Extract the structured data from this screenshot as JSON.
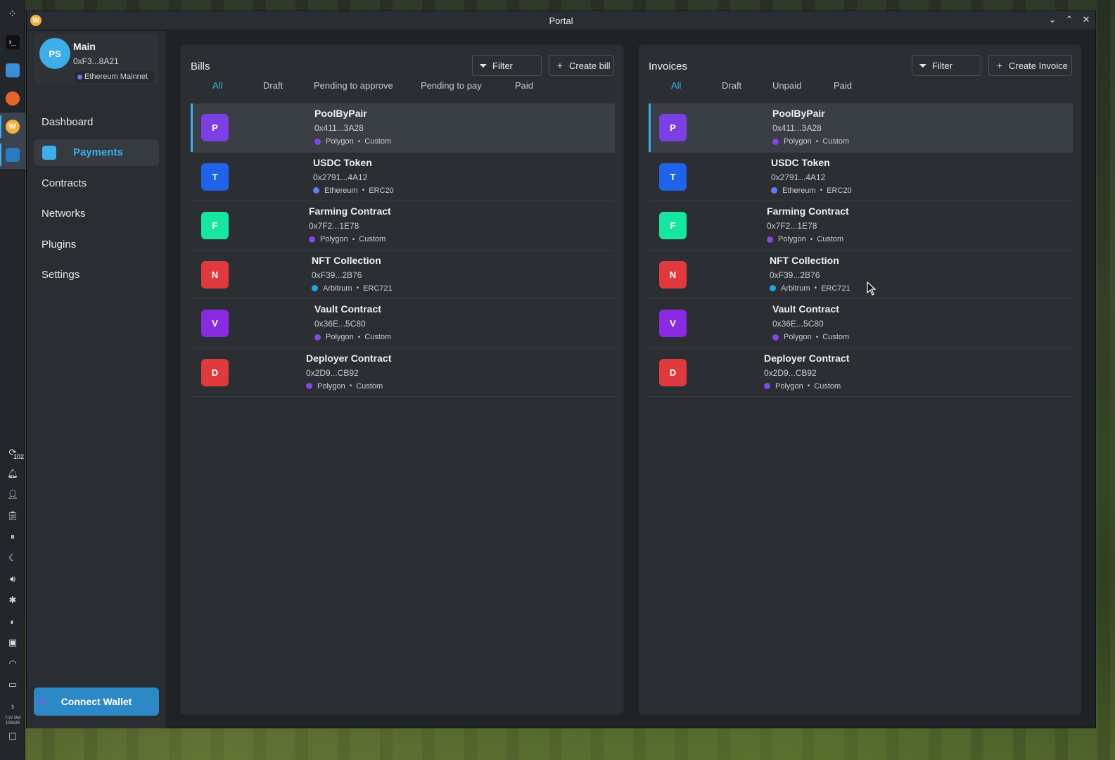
{
  "window": {
    "title": "Portal",
    "app_icon_letter": "W"
  },
  "dock": {
    "clock_time": "7:37 PM",
    "clock_date": "10/5/25",
    "notification_count": "102"
  },
  "account": {
    "initials": "PS",
    "name": "Main",
    "address": "0xF3...8A21",
    "network": "Ethereum Mainnet"
  },
  "nav": {
    "items": [
      {
        "label": "Dashboard",
        "active": false
      },
      {
        "label": "Payments",
        "active": true
      },
      {
        "label": "Contracts",
        "active": false
      },
      {
        "label": "Networks",
        "active": false
      },
      {
        "label": "Plugins",
        "active": false
      },
      {
        "label": "Settings",
        "active": false
      }
    ]
  },
  "connect_wallet": "Connect Wallet",
  "bills": {
    "title": "Bills",
    "filter": "Filter",
    "create": "Create bill",
    "tabs": [
      "All",
      "Draft",
      "Pending to approve",
      "Pending to pay",
      "Paid"
    ],
    "active_tab": "All"
  },
  "invoices": {
    "title": "Invoices",
    "filter": "Filter",
    "create": "Create Invoice",
    "tabs": [
      "All",
      "Draft",
      "Unpaid",
      "Paid"
    ],
    "active_tab": "All"
  },
  "contracts": [
    {
      "letter": "P",
      "name": "PoolByPair",
      "address": "0x411...3A28",
      "network": "Polygon",
      "type": "Custom",
      "color": "#7b3fe4",
      "net_color": "#8247e5"
    },
    {
      "letter": "T",
      "name": "USDC Token",
      "address": "0x2791...4A12",
      "network": "Ethereum",
      "type": "ERC20",
      "color": "#1e63e9",
      "net_color": "#627eea"
    },
    {
      "letter": "F",
      "name": "Farming Contract",
      "address": "0x7F2...1E78",
      "network": "Polygon",
      "type": "Custom",
      "color": "#16e6a0",
      "net_color": "#8247e5"
    },
    {
      "letter": "N",
      "name": "NFT Collection",
      "address": "0xF39...2B76",
      "network": "Arbitrum",
      "type": "ERC721",
      "color": "#e03a3e",
      "net_color": "#28a0f0"
    },
    {
      "letter": "V",
      "name": "Vault Contract",
      "address": "0x36E...5C80",
      "network": "Polygon",
      "type": "Custom",
      "color": "#8a2be2",
      "net_color": "#8247e5"
    },
    {
      "letter": "D",
      "name": "Deployer Contract",
      "address": "0x2D9...CB92",
      "network": "Polygon",
      "type": "Custom",
      "color": "#e03a3e",
      "net_color": "#8247e5"
    }
  ]
}
